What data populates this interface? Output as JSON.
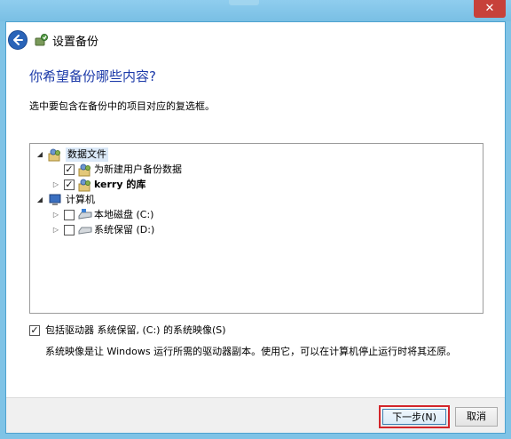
{
  "window": {
    "close_glyph": "✕",
    "back_icon": "back-arrow-icon",
    "title": "设置备份"
  },
  "page": {
    "heading": "你希望备份哪些内容?",
    "description": "选中要包含在备份中的项目对应的复选框。"
  },
  "tree": {
    "data_files": {
      "label": "数据文件",
      "icon": "users-icon"
    },
    "new_users": {
      "label": "为新建用户备份数据",
      "checked": true
    },
    "kerry": {
      "label": "kerry 的库",
      "checked": true
    },
    "computer": {
      "label": "计算机",
      "icon": "computer-icon"
    },
    "local_disk": {
      "label": "本地磁盘 (C:)",
      "checked": false
    },
    "system_reserved": {
      "label": "系统保留 (D:)",
      "checked": false
    }
  },
  "system_image": {
    "checkbox_label": "包括驱动器 系统保留, (C:) 的系统映像(S)",
    "checked": true,
    "note": "系统映像是让 Windows 运行所需的驱动器副本。使用它，可以在计算机停止运行时将其还原。"
  },
  "footer": {
    "next_label": "下一步(N)",
    "cancel_label": "取消"
  },
  "colors": {
    "heading": "#1c3aa9",
    "highlight_border": "#d3262b",
    "titlebar": "#7fc3e6"
  }
}
